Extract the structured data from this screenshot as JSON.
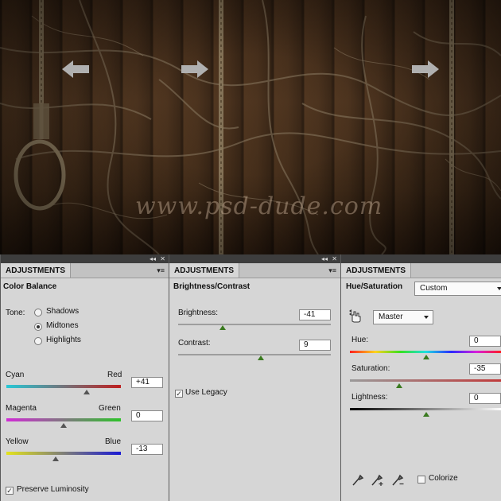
{
  "scene": {
    "watermark": "www.psd-dude.com"
  },
  "panels": [
    {
      "tab": "ADJUSTMENTS",
      "title": "Color Balance",
      "tone_label": "Tone:",
      "tones": [
        "Shadows",
        "Midtones",
        "Highlights"
      ],
      "selected_tone": "Midtones",
      "sliders": [
        {
          "left": "Cyan",
          "right": "Red",
          "value": "+41",
          "position": 0.705
        },
        {
          "left": "Magenta",
          "right": "Green",
          "value": "0",
          "position": 0.5
        },
        {
          "left": "Yellow",
          "right": "Blue",
          "value": "-13",
          "position": 0.435
        }
      ],
      "preserve_luminosity": "Preserve Luminosity"
    },
    {
      "tab": "ADJUSTMENTS",
      "title": "Brightness/Contrast",
      "sliders": [
        {
          "label": "Brightness:",
          "value": "-41",
          "position": 0.295
        },
        {
          "label": "Contrast:",
          "value": "9",
          "position": 0.545
        }
      ],
      "use_legacy": "Use Legacy"
    },
    {
      "tab": "ADJUSTMENTS",
      "title": "Hue/Saturation",
      "preset": "Custom",
      "channel": "Master",
      "sliders": [
        {
          "label": "Hue:",
          "value": "0",
          "position": 0.5
        },
        {
          "label": "Saturation:",
          "value": "-35",
          "position": 0.325
        },
        {
          "label": "Lightness:",
          "value": "0",
          "position": 0.5
        }
      ],
      "colorize": "Colorize"
    }
  ],
  "window_controls": {
    "collapse": "◂◂",
    "close": "✕",
    "menu": "▾≡"
  }
}
